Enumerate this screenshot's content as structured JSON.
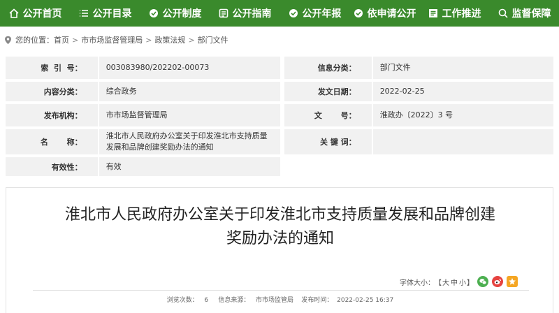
{
  "nav": {
    "items": [
      {
        "label": "公开首页",
        "icon": "home-icon"
      },
      {
        "label": "公开目录",
        "icon": "list-icon"
      },
      {
        "label": "公开制度",
        "icon": "institution-icon"
      },
      {
        "label": "公开指南",
        "icon": "guide-icon"
      },
      {
        "label": "公开年报",
        "icon": "report-icon"
      },
      {
        "label": "依申请公开",
        "icon": "apply-icon"
      },
      {
        "label": "工作推进",
        "icon": "progress-icon"
      },
      {
        "label": "监督保障",
        "icon": "supervise-icon"
      }
    ]
  },
  "breadcrumb": {
    "prefix": "您的位置：",
    "items": [
      "首页",
      "市市场监督管理局",
      "政策法规",
      "部门文件"
    ],
    "separator": ">"
  },
  "info": {
    "index_label": "索  引  号：",
    "index_value": "003083980/202202-00073",
    "category_label": "信息分类：",
    "category_value": "部门文件",
    "content_label": "内容分类：",
    "content_value": "综合政务",
    "date_label": "发文日期：",
    "date_value": "2022-02-25",
    "org_label": "发布机构：",
    "org_value": "市市场监督管理局",
    "docno_label": "文       号：",
    "docno_value": "淮政办〔2022〕3 号",
    "name_label": "名       称：",
    "name_value": "淮北市人民政府办公室关于印发淮北市支持质量发展和品牌创建奖励办法的通知",
    "keyword_label": "关 键 词：",
    "keyword_value": "",
    "valid_label": "有效性：",
    "valid_value": "有效"
  },
  "article": {
    "title_line1": "淮北市人民政府办公室关于印发淮北市支持质量发展和品牌创建",
    "title_line2": "奖励办法的通知",
    "font_size_label": "字体大小：",
    "bracket_open": "【",
    "size_large": "大",
    "size_medium": "中",
    "size_small": "小",
    "bracket_close": "】",
    "meta": "浏览次数：   6     信息来源：   市市场监管局    发布时间：  2022-02-25 16:37"
  },
  "colors": {
    "nav_bg": "#3a8a2c",
    "table_bg": "#f1f1f1",
    "wechat": "#4caf50",
    "weibo": "#e64340",
    "qzone": "#f5a623"
  }
}
